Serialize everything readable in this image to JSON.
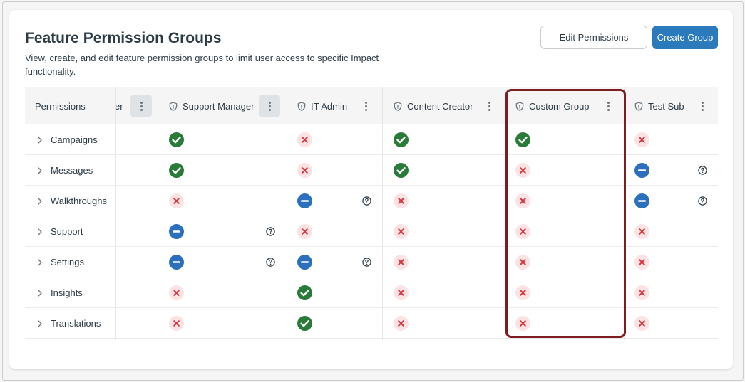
{
  "page": {
    "title": "Feature Permission Groups",
    "subtitle": "View, create, and edit feature permission groups to limit user access to specific Impact functionality."
  },
  "actions": {
    "edit_label": "Edit Permissions",
    "create_label": "Create Group"
  },
  "table": {
    "permissions_header": "Permissions",
    "truncated_header": "er",
    "groups": [
      {
        "name": "Support Manager"
      },
      {
        "name": "IT Admin"
      },
      {
        "name": "Content Creator"
      },
      {
        "name": "Custom Group"
      },
      {
        "name": "Test Sub"
      }
    ],
    "rows": [
      {
        "label": "Campaigns",
        "values": [
          "allowed",
          "denied",
          "allowed",
          "allowed",
          "denied"
        ]
      },
      {
        "label": "Messages",
        "values": [
          "allowed",
          "denied",
          "allowed",
          "denied",
          "partial"
        ]
      },
      {
        "label": "Walkthroughs",
        "values": [
          "denied",
          "partial",
          "denied",
          "denied",
          "partial"
        ]
      },
      {
        "label": "Support",
        "values": [
          "partial",
          "denied",
          "denied",
          "denied",
          "denied"
        ]
      },
      {
        "label": "Settings",
        "values": [
          "partial",
          "partial",
          "denied",
          "denied",
          "denied"
        ]
      },
      {
        "label": "Insights",
        "values": [
          "denied",
          "allowed",
          "denied",
          "denied",
          "denied"
        ]
      },
      {
        "label": "Translations",
        "values": [
          "denied",
          "allowed",
          "denied",
          "denied",
          "denied"
        ]
      }
    ],
    "highlighted_group": "Custom Group"
  },
  "colors": {
    "allowed": "#2a7b3a",
    "denied_bg": "#fbe3e4",
    "denied_fg": "#d9363e",
    "partial": "#2b6fbd",
    "primary": "#2b7abc",
    "highlight": "#7d1d22"
  },
  "icons": {
    "allowed": "check-circle-icon",
    "denied": "x-icon",
    "partial": "minus-circle-icon",
    "help": "question-circle-icon",
    "shield": "shield-icon",
    "expand": "chevron-right-icon",
    "menu": "kebab-menu-icon"
  }
}
